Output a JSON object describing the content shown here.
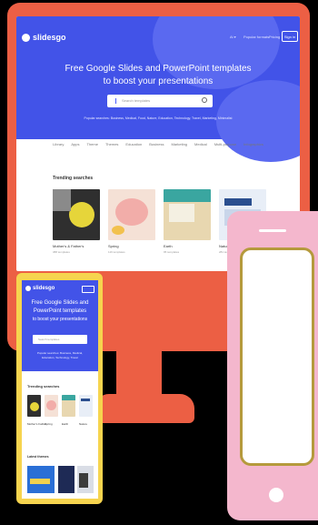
{
  "colors": {
    "monitor": "#ec5f44",
    "hero_blue": "#4253e8",
    "hero_blob": "#5a69f0",
    "tablet_frame": "#f6d44e",
    "phone_body": "#f4b7cd",
    "phone_screen_border": "#b59a3c",
    "thumb_dark": "#2f2f2f",
    "thumb_yellow": "#e6d53a",
    "thumb_pink": "#f5e1d6",
    "thumb_teal": "#3aa6a0",
    "thumb_light": "#e8eef7"
  },
  "site": {
    "logo": "slidesgo",
    "nav": [
      "Ai ▾",
      "Popular formats",
      "Pricing"
    ],
    "sign_in": "Sign in",
    "headline_1": "Free Google Slides and PowerPoint templates",
    "headline_2": "to boost your presentations",
    "search_placeholder": "Search templates",
    "popular": "Popular searches: Business, Medical, Food, Nature, Education, Technology, Travel, Marketing, Minimalist",
    "categories": [
      "Library",
      "Apps",
      "Theme",
      "Themes",
      "Education",
      "Business",
      "Marketing",
      "Medical",
      "Multi-purpose",
      "Infographics"
    ],
    "trending_title": "Trending searches",
    "trending": [
      {
        "label": "Mother's & Father's",
        "sub": "388 templates"
      },
      {
        "label": "Spring",
        "sub": "116 templates"
      },
      {
        "label": "Earth",
        "sub": "95 templates"
      },
      {
        "label": "Nature",
        "sub": "281 templates"
      }
    ]
  },
  "tablet": {
    "logo": "slidesgo",
    "line_1": "Free Google Slides and",
    "line_2": "PowerPoint templates",
    "line_3": "to boost your presentations",
    "search_placeholder": "Search templates",
    "popular_1": "Popular searches: Business, Medical,",
    "popular_2": "Education, Technology, Travel",
    "trending_title": "Trending searches",
    "trending": [
      "Mother's Father",
      "Spring",
      "Earth",
      "Nature"
    ],
    "latest_title": "Latest themes"
  }
}
